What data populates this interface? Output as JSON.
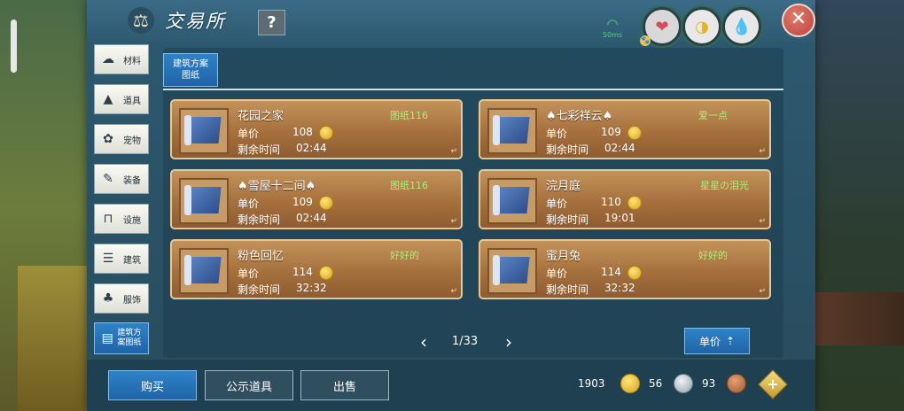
{
  "header": {
    "title": "交易所",
    "help_label": "?",
    "ping": "50ms"
  },
  "sidebar": {
    "items": [
      {
        "label": "材料",
        "icon": "materials-icon"
      },
      {
        "label": "道具",
        "icon": "items-icon"
      },
      {
        "label": "宠物",
        "icon": "pet-paw-icon"
      },
      {
        "label": "装备",
        "icon": "equipment-icon"
      },
      {
        "label": "设施",
        "icon": "facility-icon"
      },
      {
        "label": "建筑",
        "icon": "building-icon"
      },
      {
        "label": "服饰",
        "icon": "clothing-icon"
      },
      {
        "label": "建筑方案图纸",
        "icon": "blueprint-icon",
        "active": true
      }
    ]
  },
  "subtab": {
    "label": "建筑方案图纸"
  },
  "listing_labels": {
    "price": "单价",
    "time": "剩余时间"
  },
  "listings": [
    {
      "name": "花园之家",
      "seller": "图纸116",
      "price": "108",
      "time": "02:44"
    },
    {
      "name": "♠七彩祥云♠",
      "seller": "爱一点",
      "price": "109",
      "time": "02:44"
    },
    {
      "name": "♠雪屋十二间♠",
      "seller": "图纸116",
      "price": "109",
      "time": "02:44"
    },
    {
      "name": "浣月庭",
      "seller": "星星の泪光",
      "price": "110",
      "time": "19:01"
    },
    {
      "name": "粉色回忆",
      "seller": "好好的",
      "price": "114",
      "time": "32:32"
    },
    {
      "name": "蜜月兔",
      "seller": "好好的",
      "price": "114",
      "time": "32:32"
    }
  ],
  "pager": {
    "text": "1/33"
  },
  "sort": {
    "label": "单价"
  },
  "actions": {
    "buy": "购买",
    "publicize": "公示道具",
    "sell": "出售"
  },
  "currency": {
    "gold": "1903",
    "silver": "56",
    "bronze": "93"
  }
}
